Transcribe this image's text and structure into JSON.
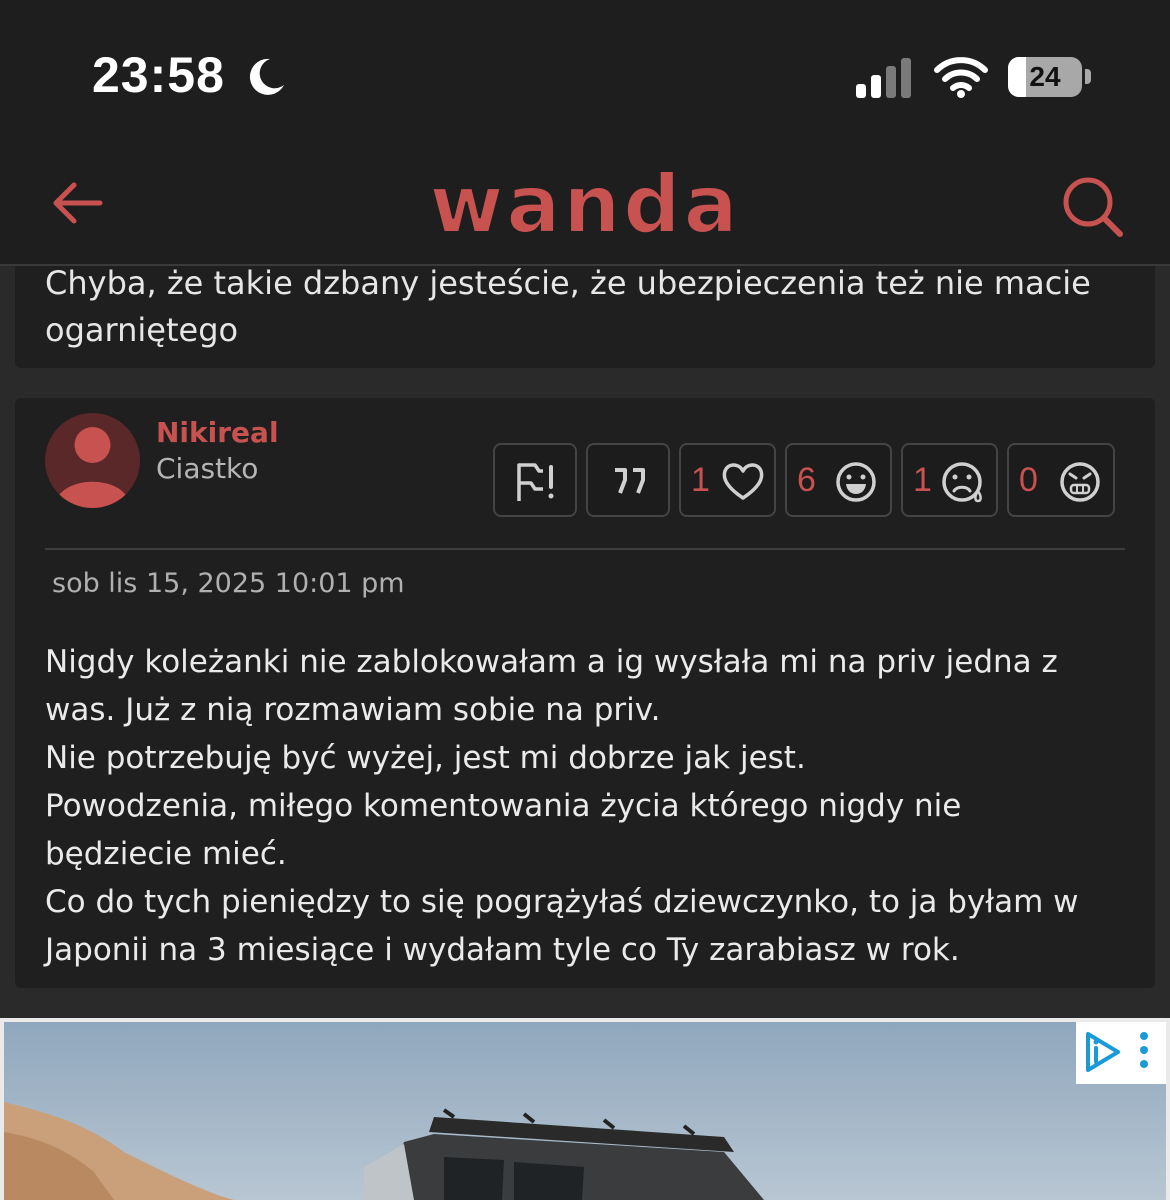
{
  "status_bar": {
    "time": "23:58",
    "battery": "24",
    "battery_level": 0.24
  },
  "navbar": {
    "logo_text": "wanda"
  },
  "previous_post": {
    "lines": [
      "Chyba, że takie dzbany jesteście, że ubezpieczenia też nie macie",
      "ogarniętego"
    ]
  },
  "post": {
    "username": "Nikireal",
    "rank": "Ciastko",
    "reactions": {
      "like": "1",
      "laugh": "6",
      "sad": "1",
      "angry": "0"
    },
    "date": "sob lis 15, 2025 10:01 pm",
    "body_lines": [
      "Nigdy koleżanki nie zablokowałam a ig wysłała mi na priv jedna z",
      "was. Już z nią rozmawiam sobie na priv.",
      "Nie potrzebuję być wyżej, jest mi dobrze jak jest.",
      "Powodzenia, miłego komentowania życia którego nigdy nie",
      "będziecie mieć.",
      "Co do tych pieniędzy to się pogrążyłaś dziewczynko, to ja byłam w",
      "Japonii na 3 miesiące i wydałam tyle co Ty zarabiasz w rok."
    ]
  },
  "colors": {
    "accent": "#c85250",
    "background": "#2a2a2a",
    "card": "#1f1f1f"
  },
  "icons": [
    "back-arrow-icon",
    "search-icon",
    "report-flag-icon",
    "quote-icon",
    "heart-icon",
    "laugh-icon",
    "sad-icon",
    "angry-icon",
    "adchoices-icon",
    "ad-menu-icon"
  ]
}
